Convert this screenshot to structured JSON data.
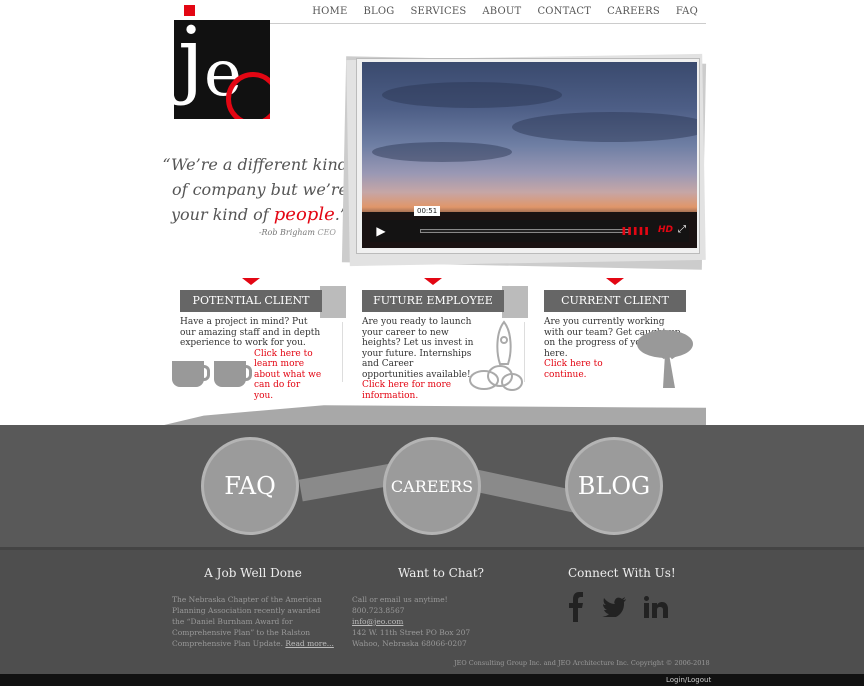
{
  "nav": {
    "items": [
      "HOME",
      "BLOG",
      "SERVICES",
      "ABOUT",
      "CONTACT",
      "CAREERS",
      "FAQ"
    ]
  },
  "logo": {
    "text": "jeo"
  },
  "quote": {
    "line1": "“We’re a different kind",
    "line2": "of company but we’re",
    "line3_pre": "your kind of ",
    "line3_red": "people",
    "line3_post": ".”",
    "author": "-Rob Brigham",
    "role": "CEO"
  },
  "video": {
    "time": "00:51",
    "hd": "HD",
    "accent": "#e30613"
  },
  "categories": [
    {
      "title": "POTENTIAL CLIENT",
      "text": "Have a project in mind? Put our amazing staff and in depth experience to work for you.",
      "link": "Click here to learn more about what we can do for you."
    },
    {
      "title": "FUTURE EMPLOYEE",
      "text": "Are you ready to launch your career to new heights? Let us invest in your future. Internships and Career opportunities available!",
      "link": "Click here for more information."
    },
    {
      "title": "CURRENT CLIENT",
      "text": "Are you currently working with our team? Get caught up on the progress of your project here.",
      "link": "Click here to continue."
    }
  ],
  "circles": [
    "FAQ",
    "CAREERS",
    "BLOG"
  ],
  "footer": {
    "col1": {
      "title": "A Job Well Done",
      "text": "The Nebraska Chapter of the American Planning Association recently awarded the “Daniel Burnham Award for Comprehensive Plan” to the Ralston Comprehensive Plan Update.",
      "link": "Read more..."
    },
    "col2": {
      "title": "Want to Chat?",
      "line1": "Call or email us anytime!",
      "phone": "800.723.8567",
      "email": "info@jeo.com",
      "addr1": "142 W. 11th Street PO Box 207",
      "addr2": "Wahoo, Nebraska 68066-0207"
    },
    "col3": {
      "title": "Connect With Us!"
    },
    "copyright": "JEO Consulting Group Inc. and JEO Architecture Inc. Copyright © 2006-2018",
    "login": "Login/Logout"
  }
}
